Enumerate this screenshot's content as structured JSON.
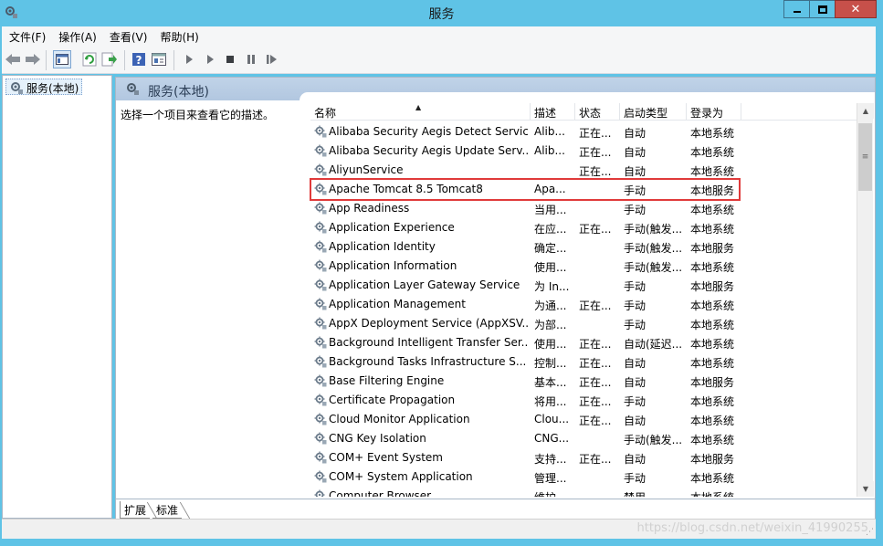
{
  "window": {
    "title": "服务"
  },
  "menubar": [
    "文件(F)",
    "操作(A)",
    "查看(V)",
    "帮助(H)"
  ],
  "toolbar": {
    "icons": [
      "back-arrow-icon",
      "forward-arrow-icon",
      "show-tree-icon",
      "refresh-icon",
      "export-list-icon",
      "help-icon",
      "properties-icon",
      "start-service-icon",
      "start-service-alt-icon",
      "stop-service-icon",
      "pause-service-icon",
      "restart-service-icon"
    ]
  },
  "tree": {
    "root_label": "服务(本地)"
  },
  "pane": {
    "title": "服务(本地)",
    "description": "选择一个项目来查看它的描述。"
  },
  "table": {
    "columns": [
      "名称",
      "描述",
      "状态",
      "启动类型",
      "登录为"
    ],
    "highlighted_row": 3,
    "rows": [
      [
        "Alibaba Security Aegis Detect Service",
        "Alib...",
        "正在...",
        "自动",
        "本地系统"
      ],
      [
        "Alibaba Security Aegis Update Serv...",
        "Alib...",
        "正在...",
        "自动",
        "本地系统"
      ],
      [
        "AliyunService",
        "",
        "正在...",
        "自动",
        "本地系统"
      ],
      [
        "Apache Tomcat 8.5 Tomcat8",
        "Apa...",
        "",
        "手动",
        "本地服务"
      ],
      [
        "App Readiness",
        "当用...",
        "",
        "手动",
        "本地系统"
      ],
      [
        "Application Experience",
        "在应...",
        "正在...",
        "手动(触发...",
        "本地系统"
      ],
      [
        "Application Identity",
        "确定...",
        "",
        "手动(触发...",
        "本地服务"
      ],
      [
        "Application Information",
        "使用...",
        "",
        "手动(触发...",
        "本地系统"
      ],
      [
        "Application Layer Gateway Service",
        "为 In...",
        "",
        "手动",
        "本地服务"
      ],
      [
        "Application Management",
        "为通...",
        "正在...",
        "手动",
        "本地系统"
      ],
      [
        "AppX Deployment Service (AppXSV...",
        "为部...",
        "",
        "手动",
        "本地系统"
      ],
      [
        "Background Intelligent Transfer Ser...",
        "使用...",
        "正在...",
        "自动(延迟...",
        "本地系统"
      ],
      [
        "Background Tasks Infrastructure S...",
        "控制...",
        "正在...",
        "自动",
        "本地系统"
      ],
      [
        "Base Filtering Engine",
        "基本...",
        "正在...",
        "自动",
        "本地服务"
      ],
      [
        "Certificate Propagation",
        "将用...",
        "正在...",
        "手动",
        "本地系统"
      ],
      [
        "Cloud Monitor Application",
        "Clou...",
        "正在...",
        "自动",
        "本地系统"
      ],
      [
        "CNG Key Isolation",
        "CNG...",
        "",
        "手动(触发...",
        "本地系统"
      ],
      [
        "COM+ Event System",
        "支持...",
        "正在...",
        "自动",
        "本地服务"
      ],
      [
        "COM+ System Application",
        "管理...",
        "",
        "手动",
        "本地系统"
      ],
      [
        "Computer Browser",
        "维护...",
        "",
        "禁用",
        "本地系统"
      ]
    ]
  },
  "tabs": [
    "扩展",
    "标准"
  ],
  "statusbar": {
    "watermark": "https://blog.csdn.net/weixin_41990255"
  },
  "colors": {
    "titlebar": "#5fc3e6",
    "close_button": "#c7504a",
    "highlight_border": "#e03a3a",
    "pane_header": "#b8cce4"
  }
}
